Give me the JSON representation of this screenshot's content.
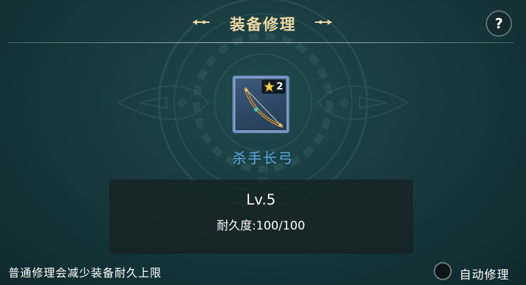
{
  "header": {
    "title": "装备修理",
    "help_label": "?",
    "title_color": "#f0d7a0"
  },
  "item": {
    "name": "杀手长弓",
    "stars": "2",
    "icon": "longbow-icon",
    "name_color": "#5fa6e6",
    "frame_color": "#6e8ec0"
  },
  "info": {
    "level": "Lv.5",
    "durability_label": "耐久度:",
    "durability_value": "100/100"
  },
  "footer": {
    "hint": "普通修理会减少装备耐久上限",
    "auto_repair_label": "自动修理",
    "auto_repair_checked": false
  }
}
